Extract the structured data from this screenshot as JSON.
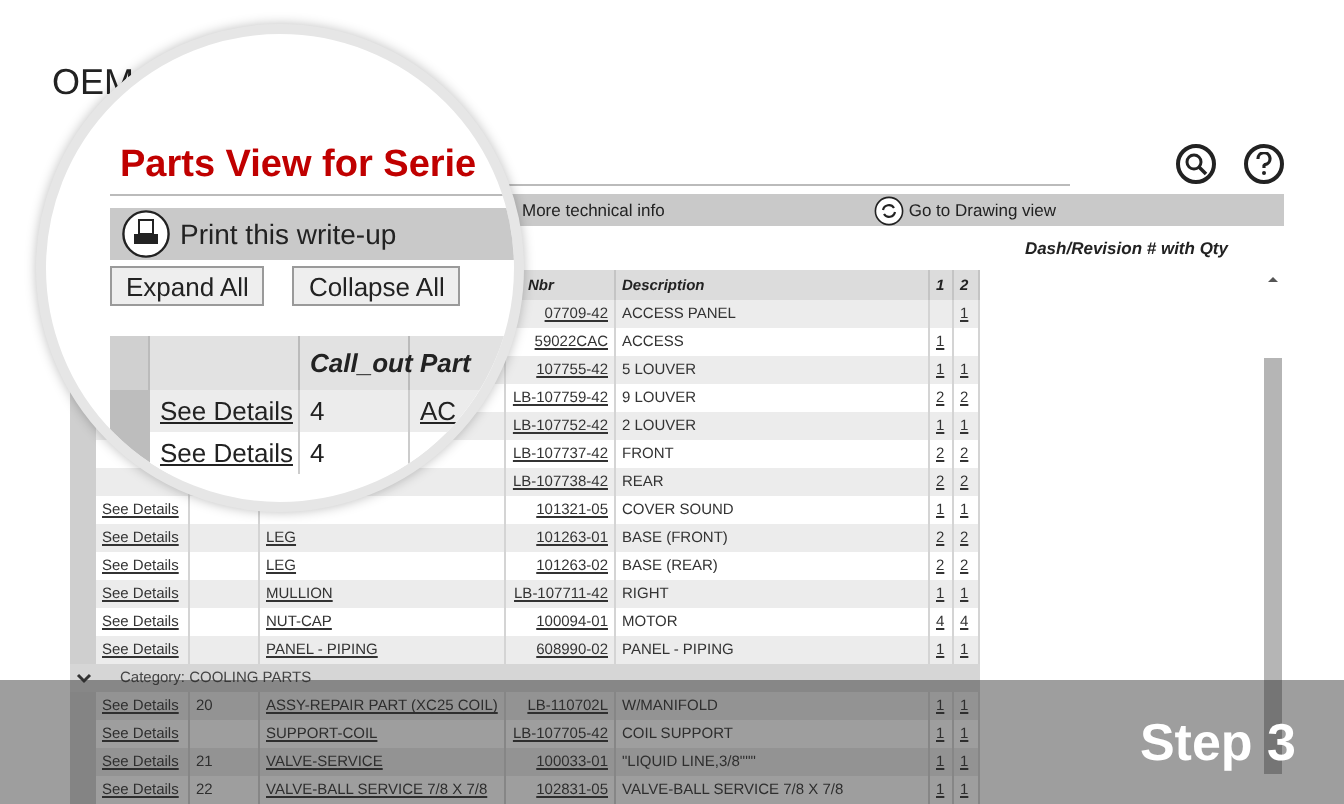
{
  "header": {
    "brand": "OEM"
  },
  "toolbar": {
    "info_link": "More technical info",
    "drawing_link": "Go to Drawing view"
  },
  "qty_heading": "Dash/Revision # with Qty",
  "table": {
    "columns": [
      "Nbr",
      "Description",
      "1",
      "2"
    ],
    "rows": [
      {
        "kind": "part",
        "part_nbr": "07709-42",
        "description": "ACCESS PANEL",
        "qty_2": "1"
      },
      {
        "kind": "part",
        "part_nbr": "59022CAC",
        "description": "ACCESS",
        "qty_1": "1"
      },
      {
        "kind": "part",
        "part_nbr": "107755-42",
        "description": "5 LOUVER",
        "qty_1": "1",
        "qty_2": "1"
      },
      {
        "kind": "part",
        "part_nbr": "LB-107759-42",
        "description": "9 LOUVER",
        "qty_1": "2",
        "qty_2": "2"
      },
      {
        "kind": "part",
        "part_nbr": "LB-107752-42",
        "description": "2 LOUVER",
        "qty_1": "1",
        "qty_2": "1"
      },
      {
        "kind": "part",
        "part_nbr": "LB-107737-42",
        "description": "FRONT",
        "qty_1": "2",
        "qty_2": "2"
      },
      {
        "kind": "part",
        "part_nbr": "LB-107738-42",
        "description": "REAR",
        "qty_1": "2",
        "qty_2": "2"
      },
      {
        "kind": "part",
        "details": "See Details",
        "part_nbr": "101321-05",
        "description": "COVER SOUND",
        "qty_1": "1",
        "qty_2": "1"
      },
      {
        "kind": "part",
        "details": "See Details",
        "part_name": "LEG",
        "part_nbr": "101263-01",
        "description": "BASE (FRONT)",
        "qty_1": "2",
        "qty_2": "2"
      },
      {
        "kind": "part",
        "details": "See Details",
        "part_name": "LEG",
        "part_nbr": "101263-02",
        "description": "BASE (REAR)",
        "qty_1": "2",
        "qty_2": "2"
      },
      {
        "kind": "part",
        "details": "See Details",
        "part_name": "MULLION",
        "part_nbr": "LB-107711-42",
        "description": "RIGHT",
        "qty_1": "1",
        "qty_2": "1"
      },
      {
        "kind": "part",
        "details": "See Details",
        "part_name": "NUT-CAP",
        "part_nbr": "100094-01",
        "description": "MOTOR",
        "qty_1": "4",
        "qty_2": "4"
      },
      {
        "kind": "part",
        "details": "See Details",
        "part_name": "PANEL - PIPING",
        "part_nbr": "608990-02",
        "description": "PANEL - PIPING",
        "qty_1": "1",
        "qty_2": "1"
      },
      {
        "kind": "category",
        "label": "Category: COOLING PARTS",
        "expanded": true
      },
      {
        "kind": "part",
        "details": "See Details",
        "call_out": "20",
        "part_name": "ASSY-REPAIR PART (XC25 COIL)",
        "part_nbr": "LB-110702L",
        "description": "W/MANIFOLD",
        "qty_1": "1",
        "qty_2": "1"
      },
      {
        "kind": "part",
        "details": "See Details",
        "part_name": "SUPPORT-COIL",
        "part_nbr": "LB-107705-42",
        "description": "COIL SUPPORT",
        "qty_1": "1",
        "qty_2": "1"
      },
      {
        "kind": "part",
        "details": "See Details",
        "call_out": "21",
        "part_name": "VALVE-SERVICE",
        "part_nbr": "100033-01",
        "description": "\"LIQUID LINE,3/8\"\"\"",
        "qty_1": "1",
        "qty_2": "1"
      },
      {
        "kind": "part",
        "details": "See Details",
        "call_out": "22",
        "part_name": "VALVE-BALL SERVICE 7/8 X 7/8",
        "part_nbr": "102831-05",
        "description": "VALVE-BALL SERVICE 7/8 X 7/8",
        "qty_1": "1",
        "qty_2": "1"
      }
    ]
  },
  "magnifier": {
    "title": "Parts View for Serie",
    "print_link": "Print this write-up",
    "buttons": [
      "Expand All",
      "Collapse All"
    ],
    "columns": [
      "Call_out",
      "Part"
    ],
    "rows": [
      {
        "details": "See Details",
        "call_out": "4",
        "part": "AC"
      },
      {
        "details": "See Details",
        "call_out": "4"
      }
    ]
  },
  "step_label": "Step 3"
}
